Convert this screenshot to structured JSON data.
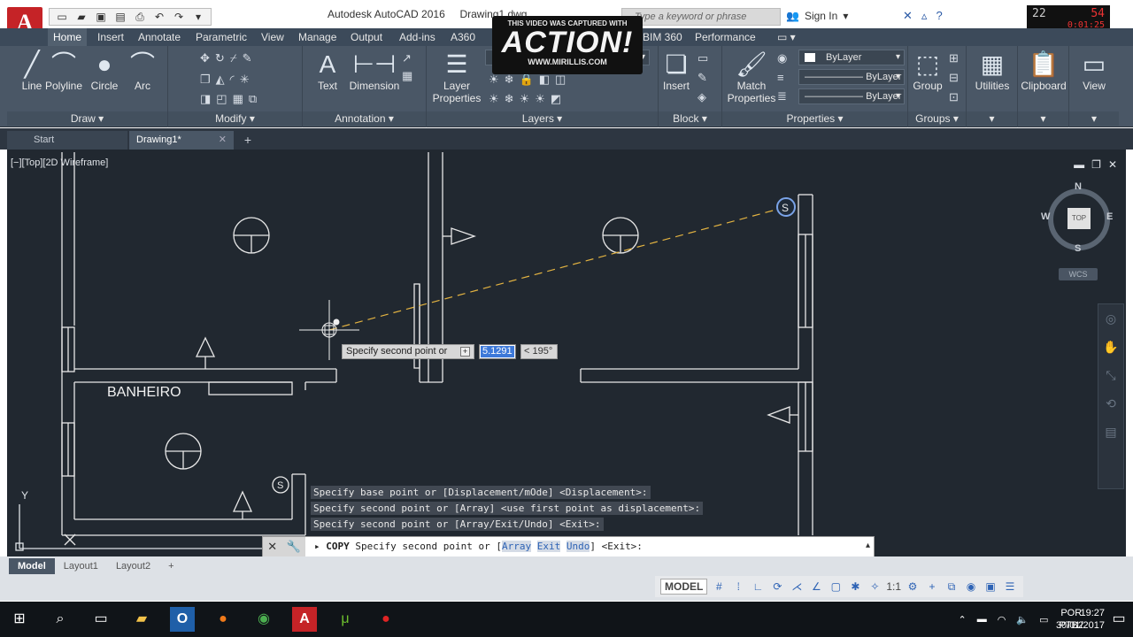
{
  "title": {
    "app_name": "Autodesk AutoCAD 2016",
    "document": "Drawing1.dwg",
    "search_placeholder": "Type a keyword or phrase",
    "sign_in": "Sign In"
  },
  "overlay": {
    "line1": "THIS VIDEO WAS CAPTURED WITH",
    "logo": "ACTION!",
    "site": "WWW.MIRILLIS.COM",
    "rec_fps": "22",
    "rec_count": "54",
    "rec_time": "0:01:25"
  },
  "ribbon_tabs": [
    "Home",
    "Insert",
    "Annotate",
    "Parametric",
    "View",
    "Manage",
    "Output",
    "Add-ins",
    "A360",
    "BIM 360",
    "Performance"
  ],
  "ribbon": {
    "draw": {
      "title": "Draw",
      "line": "Line",
      "polyline": "Polyline",
      "circle": "Circle",
      "arc": "Arc"
    },
    "modify": {
      "title": "Modify"
    },
    "annotation": {
      "title": "Annotation",
      "text": "Text",
      "dimension": "Dimension"
    },
    "layers": {
      "title": "Layers",
      "layer_properties": "Layer Properties"
    },
    "block": {
      "title": "Block",
      "insert": "Insert"
    },
    "properties": {
      "title": "Properties",
      "match": "Match Properties",
      "color": "ByLayer",
      "linetype": "ByLayer",
      "lineweight": "ByLayer"
    },
    "groups": {
      "title": "Groups",
      "group": "Group"
    },
    "utilities": "Utilities",
    "clipboard": "Clipboard",
    "view": "View"
  },
  "doc_tabs": [
    {
      "label": "Start"
    },
    {
      "label": "Drawing1*"
    }
  ],
  "viewport": {
    "label": "[−][Top][2D Wireframe]",
    "room_label": "BANHEIRO",
    "viewcube_top": "TOP",
    "north": "N",
    "south": "S",
    "east": "E",
    "west": "W",
    "wcs": "WCS",
    "ucs_y": "Y"
  },
  "dynamic_input": {
    "prompt": "Specify second point or",
    "distance": "5.1291",
    "angle": "< 195°"
  },
  "command_history": [
    "Specify base point or [Displacement/mOde] <Displacement>:",
    "Specify second point or [Array] <use first point as displacement>:",
    "Specify second point or [Array/Exit/Undo] <Exit>:"
  ],
  "command_line": {
    "command": "COPY",
    "prompt_start": "Specify second point or [",
    "options": [
      "Array",
      "Exit",
      "Undo"
    ],
    "prompt_end": "] <Exit>:"
  },
  "layout_tabs": [
    "Model",
    "Layout1",
    "Layout2"
  ],
  "status": {
    "model": "MODEL",
    "scale": "1:1"
  },
  "taskbar": {
    "lang_top": "POR",
    "lang_bottom": "PTB2",
    "time": "19:27",
    "date": "30/01/2017"
  }
}
